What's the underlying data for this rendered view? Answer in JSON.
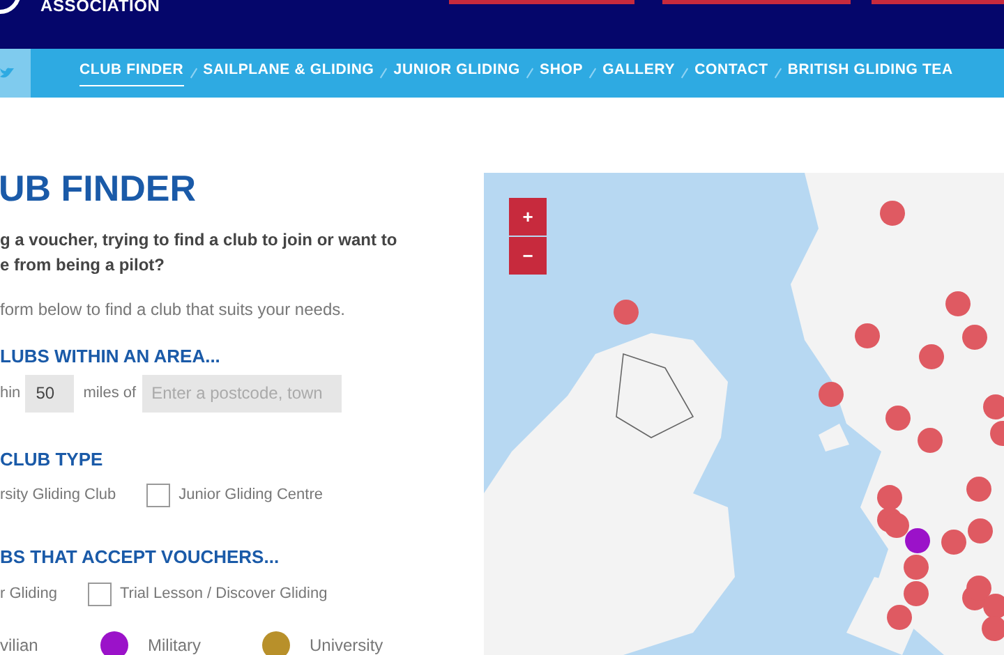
{
  "header": {
    "org_text": "ASSOCIATION"
  },
  "nav": {
    "items": [
      {
        "label": "CLUB FINDER",
        "selected": true
      },
      {
        "label": "SAILPLANE & GLIDING",
        "selected": false
      },
      {
        "label": "JUNIOR GLIDING",
        "selected": false
      },
      {
        "label": "SHOP",
        "selected": false
      },
      {
        "label": "GALLERY",
        "selected": false
      },
      {
        "label": "CONTACT",
        "selected": false
      },
      {
        "label": "BRITISH GLIDING TEA",
        "selected": false
      }
    ]
  },
  "finder": {
    "title": "UB FINDER",
    "intro_lines": [
      "g a voucher, trying to find a club to join or want to",
      "e from being a pilot?"
    ],
    "instruction": "form below to find a club that suits your needs.",
    "area": {
      "heading": "LUBS WITHIN AN AREA...",
      "prefix": "hin",
      "miles": "50",
      "miles_label": "miles of",
      "postcode_placeholder": "Enter a postcode, town"
    },
    "club_type": {
      "heading": "CLUB TYPE",
      "options": [
        {
          "label": "rsity Gliding Club"
        },
        {
          "label": "Junior Gliding Centre",
          "checked": false
        }
      ]
    },
    "vouchers": {
      "heading": "BS THAT ACCEPT VOUCHERS...",
      "options": [
        {
          "label": "r Gliding"
        },
        {
          "label": "Trial Lesson / Discover Gliding",
          "checked": false
        }
      ]
    },
    "legend": [
      {
        "label": "vilian"
      },
      {
        "label": "Military",
        "color": "#9b12c9"
      },
      {
        "label": "University",
        "color": "#b8902a"
      }
    ]
  },
  "map": {
    "zoom_in": "+",
    "zoom_out": "−"
  }
}
